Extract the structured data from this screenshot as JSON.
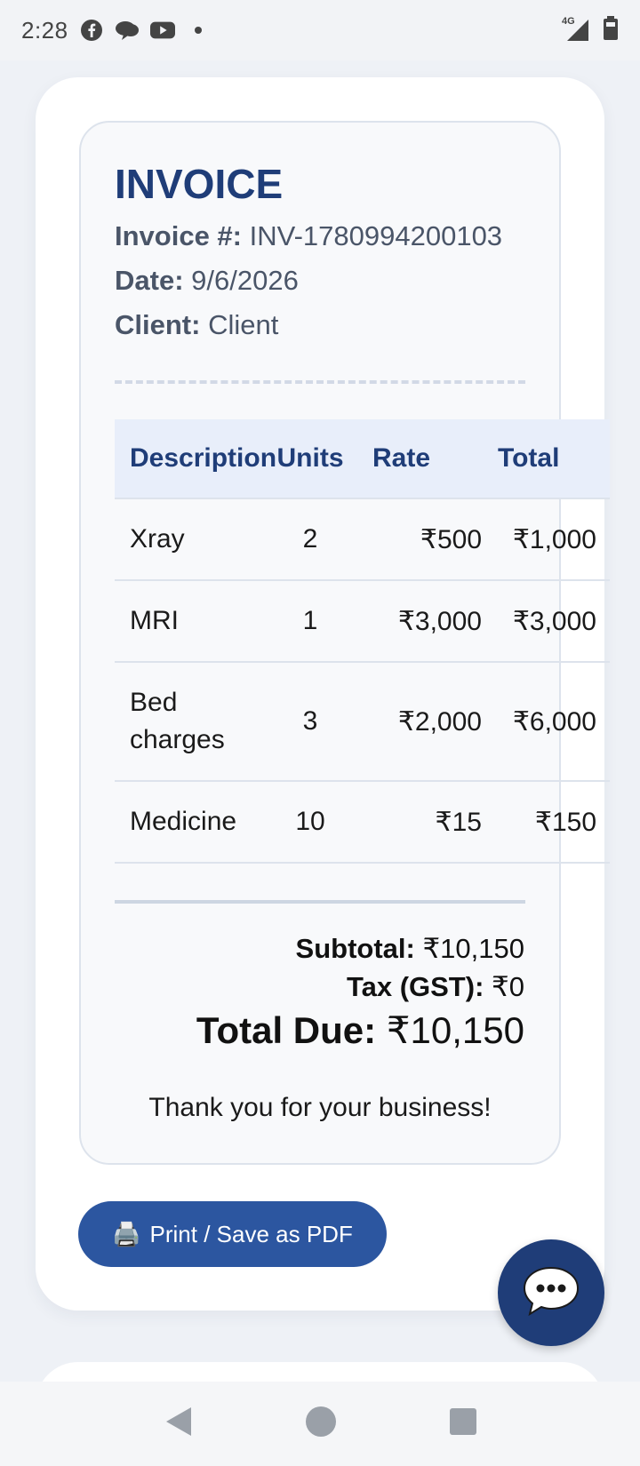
{
  "status_bar": {
    "time": "2:28",
    "network": "4G",
    "icons": [
      "facebook-icon",
      "chat-bubble-icon",
      "youtube-icon",
      "dot-icon",
      "signal-icon",
      "battery-icon"
    ]
  },
  "invoice": {
    "title": "INVOICE",
    "number_label": "Invoice #:",
    "number": "INV-1780994200103",
    "date_label": "Date:",
    "date": "9/6/2026",
    "client_label": "Client:",
    "client": "Client",
    "columns": [
      "Description",
      "Units",
      "Rate",
      "Total"
    ],
    "rows": [
      {
        "description": "Xray",
        "units": "2",
        "rate": "₹500",
        "total": "₹1,000"
      },
      {
        "description": "MRI",
        "units": "1",
        "rate": "₹3,000",
        "total": "₹3,000"
      },
      {
        "description": "Bed charges",
        "units": "3",
        "rate": "₹2,000",
        "total": "₹6,000"
      },
      {
        "description": "Medicine",
        "units": "10",
        "rate": "₹15",
        "total": "₹150"
      }
    ],
    "subtotal_label": "Subtotal:",
    "subtotal": "₹10,150",
    "tax_label": "Tax (GST):",
    "tax": "₹0",
    "total_label": "Total Due:",
    "total": "₹10,150",
    "thanks": "Thank you for your business!"
  },
  "actions": {
    "print_icon": "🖨️",
    "print_label": "Print / Save as PDF",
    "chat_icon": "chat-icon"
  },
  "nav": {
    "back": "back-icon",
    "home": "home-icon",
    "recents": "recents-icon"
  },
  "colors": {
    "accent": "#1f3d78",
    "button": "#2c56a0",
    "header_bg": "#e8eefa"
  }
}
